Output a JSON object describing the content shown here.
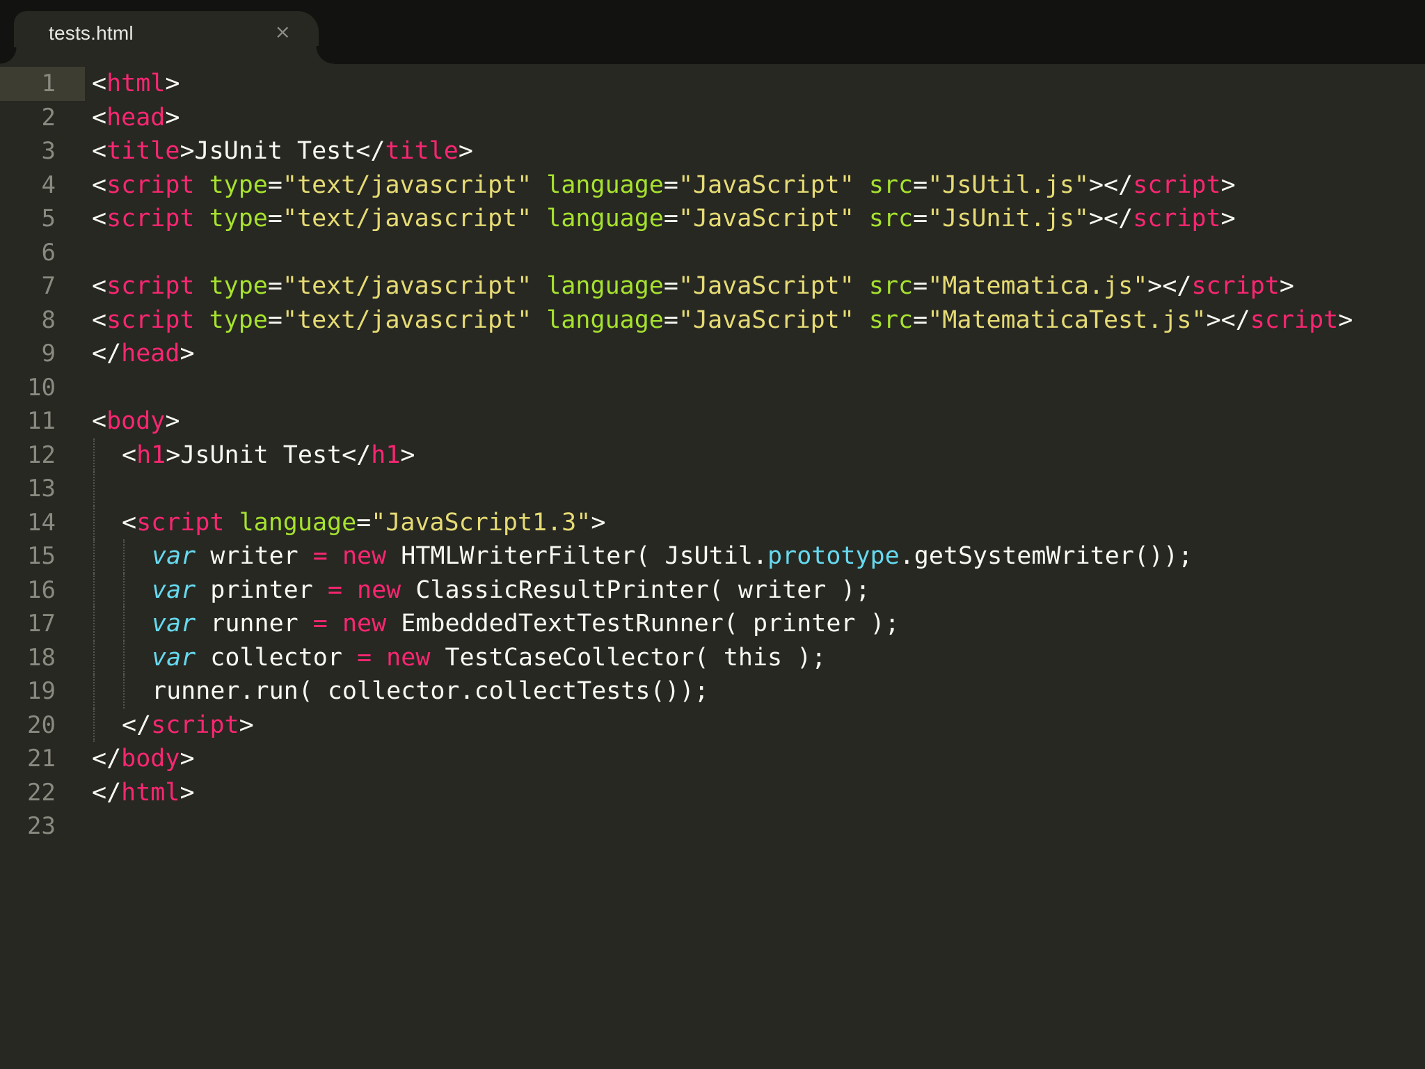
{
  "tab": {
    "title": "tests.html",
    "close": "×"
  },
  "colors": {
    "background": "#272822",
    "tab_bar": "#121310",
    "current_line": "#3e3d32",
    "tag": "#f92672",
    "attribute": "#a6e22e",
    "string": "#e6db74",
    "keyword": "#66d9ef",
    "text": "#f8f8f2",
    "gutter": "#8a8a80"
  },
  "current_line": 1,
  "lines": [
    {
      "n": "1",
      "indent": 0,
      "tokens": [
        [
          "p",
          "<"
        ],
        [
          "t",
          "html"
        ],
        [
          "p",
          ">"
        ]
      ]
    },
    {
      "n": "2",
      "indent": 0,
      "tokens": [
        [
          "p",
          "<"
        ],
        [
          "t",
          "head"
        ],
        [
          "p",
          ">"
        ]
      ]
    },
    {
      "n": "3",
      "indent": 0,
      "tokens": [
        [
          "p",
          "<"
        ],
        [
          "t",
          "title"
        ],
        [
          "p",
          ">JsUnit Test</"
        ],
        [
          "t",
          "title"
        ],
        [
          "p",
          ">"
        ]
      ]
    },
    {
      "n": "4",
      "indent": 0,
      "tokens": [
        [
          "p",
          "<"
        ],
        [
          "t",
          "script"
        ],
        [
          "p",
          " "
        ],
        [
          "a",
          "type"
        ],
        [
          "p",
          "="
        ],
        [
          "s",
          "\"text/javascript\""
        ],
        [
          "p",
          " "
        ],
        [
          "a",
          "language"
        ],
        [
          "p",
          "="
        ],
        [
          "s",
          "\"JavaScript\""
        ],
        [
          "p",
          " "
        ],
        [
          "a",
          "src"
        ],
        [
          "p",
          "="
        ],
        [
          "s",
          "\"JsUtil.js\""
        ],
        [
          "p",
          "></"
        ],
        [
          "t",
          "script"
        ],
        [
          "p",
          ">"
        ]
      ]
    },
    {
      "n": "5",
      "indent": 0,
      "tokens": [
        [
          "p",
          "<"
        ],
        [
          "t",
          "script"
        ],
        [
          "p",
          " "
        ],
        [
          "a",
          "type"
        ],
        [
          "p",
          "="
        ],
        [
          "s",
          "\"text/javascript\""
        ],
        [
          "p",
          " "
        ],
        [
          "a",
          "language"
        ],
        [
          "p",
          "="
        ],
        [
          "s",
          "\"JavaScript\""
        ],
        [
          "p",
          " "
        ],
        [
          "a",
          "src"
        ],
        [
          "p",
          "="
        ],
        [
          "s",
          "\"JsUnit.js\""
        ],
        [
          "p",
          "></"
        ],
        [
          "t",
          "script"
        ],
        [
          "p",
          ">"
        ]
      ]
    },
    {
      "n": "6",
      "indent": 0,
      "tokens": []
    },
    {
      "n": "7",
      "indent": 0,
      "tokens": [
        [
          "p",
          "<"
        ],
        [
          "t",
          "script"
        ],
        [
          "p",
          " "
        ],
        [
          "a",
          "type"
        ],
        [
          "p",
          "="
        ],
        [
          "s",
          "\"text/javascript\""
        ],
        [
          "p",
          " "
        ],
        [
          "a",
          "language"
        ],
        [
          "p",
          "="
        ],
        [
          "s",
          "\"JavaScript\""
        ],
        [
          "p",
          " "
        ],
        [
          "a",
          "src"
        ],
        [
          "p",
          "="
        ],
        [
          "s",
          "\"Matematica.js\""
        ],
        [
          "p",
          "></"
        ],
        [
          "t",
          "script"
        ],
        [
          "p",
          ">"
        ]
      ]
    },
    {
      "n": "8",
      "indent": 0,
      "tokens": [
        [
          "p",
          "<"
        ],
        [
          "t",
          "script"
        ],
        [
          "p",
          " "
        ],
        [
          "a",
          "type"
        ],
        [
          "p",
          "="
        ],
        [
          "s",
          "\"text/javascript\""
        ],
        [
          "p",
          " "
        ],
        [
          "a",
          "language"
        ],
        [
          "p",
          "="
        ],
        [
          "s",
          "\"JavaScript\""
        ],
        [
          "p",
          " "
        ],
        [
          "a",
          "src"
        ],
        [
          "p",
          "="
        ],
        [
          "s",
          "\"MatematicaTest.js\""
        ],
        [
          "p",
          "></"
        ],
        [
          "t",
          "script"
        ],
        [
          "p",
          ">"
        ]
      ]
    },
    {
      "n": "9",
      "indent": 0,
      "tokens": [
        [
          "p",
          "</"
        ],
        [
          "t",
          "head"
        ],
        [
          "p",
          ">"
        ]
      ]
    },
    {
      "n": "10",
      "indent": 0,
      "tokens": []
    },
    {
      "n": "11",
      "indent": 0,
      "tokens": [
        [
          "p",
          "<"
        ],
        [
          "t",
          "body"
        ],
        [
          "p",
          ">"
        ]
      ]
    },
    {
      "n": "12",
      "indent": 1,
      "tokens": [
        [
          "p",
          "<"
        ],
        [
          "t",
          "h1"
        ],
        [
          "p",
          ">JsUnit Test</"
        ],
        [
          "t",
          "h1"
        ],
        [
          "p",
          ">"
        ]
      ]
    },
    {
      "n": "13",
      "indent": 1,
      "tokens": []
    },
    {
      "n": "14",
      "indent": 1,
      "tokens": [
        [
          "p",
          "<"
        ],
        [
          "t",
          "script"
        ],
        [
          "p",
          " "
        ],
        [
          "a",
          "language"
        ],
        [
          "p",
          "="
        ],
        [
          "s",
          "\"JavaScript1.3\""
        ],
        [
          "p",
          ">"
        ]
      ]
    },
    {
      "n": "15",
      "indent": 2,
      "tokens": [
        [
          "k",
          "var"
        ],
        [
          "p",
          " writer "
        ],
        [
          "o",
          "="
        ],
        [
          "p",
          " "
        ],
        [
          "o",
          "new"
        ],
        [
          "p",
          " HTMLWriterFilter( JsUtil."
        ],
        [
          "r",
          "prototype"
        ],
        [
          "p",
          ".getSystemWriter());"
        ]
      ]
    },
    {
      "n": "16",
      "indent": 2,
      "tokens": [
        [
          "k",
          "var"
        ],
        [
          "p",
          " printer "
        ],
        [
          "o",
          "="
        ],
        [
          "p",
          " "
        ],
        [
          "o",
          "new"
        ],
        [
          "p",
          " ClassicResultPrinter( writer );"
        ]
      ]
    },
    {
      "n": "17",
      "indent": 2,
      "tokens": [
        [
          "k",
          "var"
        ],
        [
          "p",
          " runner "
        ],
        [
          "o",
          "="
        ],
        [
          "p",
          " "
        ],
        [
          "o",
          "new"
        ],
        [
          "p",
          " EmbeddedTextTestRunner( printer );"
        ]
      ]
    },
    {
      "n": "18",
      "indent": 2,
      "tokens": [
        [
          "k",
          "var"
        ],
        [
          "p",
          " collector "
        ],
        [
          "o",
          "="
        ],
        [
          "p",
          " "
        ],
        [
          "o",
          "new"
        ],
        [
          "p",
          " TestCaseCollector( this );"
        ]
      ]
    },
    {
      "n": "19",
      "indent": 2,
      "tokens": [
        [
          "p",
          "runner.run( collector.collectTests());"
        ]
      ]
    },
    {
      "n": "20",
      "indent": 1,
      "tokens": [
        [
          "p",
          "</"
        ],
        [
          "t",
          "script"
        ],
        [
          "p",
          ">"
        ]
      ]
    },
    {
      "n": "21",
      "indent": 0,
      "tokens": [
        [
          "p",
          "</"
        ],
        [
          "t",
          "body"
        ],
        [
          "p",
          ">"
        ]
      ]
    },
    {
      "n": "22",
      "indent": 0,
      "tokens": [
        [
          "p",
          "</"
        ],
        [
          "t",
          "html"
        ],
        [
          "p",
          ">"
        ]
      ]
    },
    {
      "n": "23",
      "indent": 0,
      "tokens": []
    }
  ]
}
